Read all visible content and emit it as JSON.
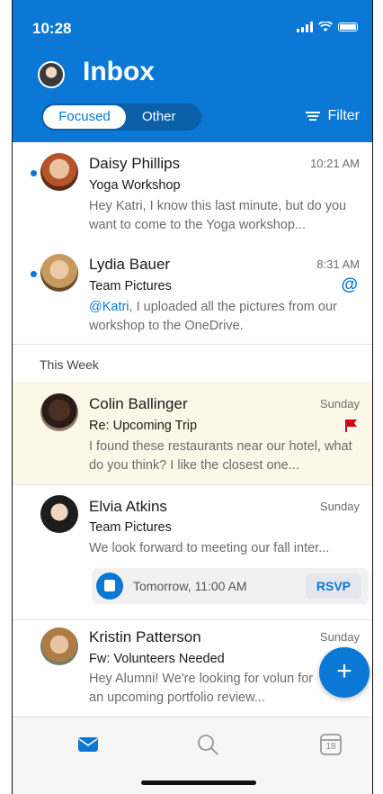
{
  "status": {
    "time": "10:28"
  },
  "header": {
    "title": "Inbox",
    "tabs": [
      "Focused",
      "Other"
    ],
    "filter_label": "Filter"
  },
  "section_label": "This Week",
  "mails": [
    {
      "sender": "Daisy Phillips",
      "time": "10:21 AM",
      "subject": "Yoga Workshop",
      "preview": "Hey Katri, I know this last minute, but do you want to come to the Yoga workshop..."
    },
    {
      "sender": "Lydia Bauer",
      "time": "8:31 AM",
      "subject": "Team Pictures",
      "mention": "@Katri",
      "preview": ", I uploaded all the pictures from our workshop to the OneDrive.",
      "mention_icon": "@"
    },
    {
      "sender": "Colin Ballinger",
      "time": "Sunday",
      "subject": "Re: Upcoming Trip",
      "preview": "I found these restaurants near our hotel, what do you think? I like the closest one..."
    },
    {
      "sender": "Elvia Atkins",
      "time": "Sunday",
      "subject": "Team Pictures",
      "preview": "We look forward to meeting our fall inter..."
    },
    {
      "sender": "Kristin Patterson",
      "time": "Sunday",
      "subject": "Fw: Volunteers Needed",
      "preview": "Hey Alumni! We're looking for volun for an upcoming portfolio review..."
    }
  ],
  "rsvp": {
    "time": "Tomorrow, 11:00 AM",
    "button": "RSVP"
  },
  "fab": "+",
  "tabs": {
    "calendar_day": "18"
  },
  "colors": {
    "accent": "#0a78d4",
    "flag": "#d0021b",
    "highlight": "#fdf7e8"
  }
}
